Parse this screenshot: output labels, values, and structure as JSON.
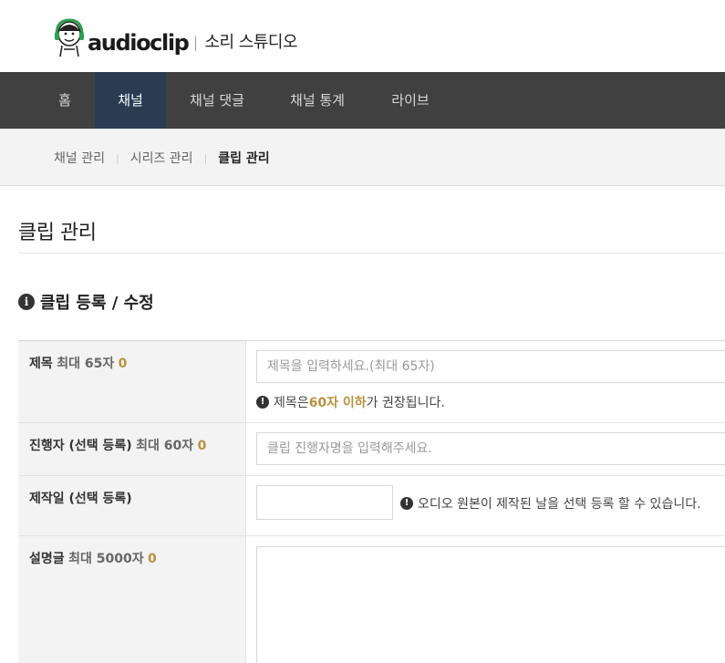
{
  "header": {
    "logo_text": "audioclip",
    "studio_label": "소리 스튜디오"
  },
  "gnb": {
    "items": [
      {
        "label": "홈"
      },
      {
        "label": "채널"
      },
      {
        "label": "채널 댓글"
      },
      {
        "label": "채널 통계"
      },
      {
        "label": "라이브"
      }
    ],
    "active_index": 1
  },
  "snb": {
    "items": [
      {
        "label": "채널 관리"
      },
      {
        "label": "시리즈 관리"
      },
      {
        "label": "클립 관리"
      }
    ],
    "separator": "|",
    "active_index": 2
  },
  "page": {
    "title": "클립 관리",
    "section_title": "클립 등록 / 수정"
  },
  "form": {
    "title": {
      "label": "제목",
      "limit": "최대 65자",
      "count": "0",
      "placeholder": "제목을 입력하세요.(최대 65자)",
      "note_prefix": "제목은 ",
      "note_highlight": "60자 이하",
      "note_suffix": "가 권장됩니다."
    },
    "host": {
      "label": "진행자 (선택 등록)",
      "limit": "최대 60자",
      "count": "0",
      "placeholder": "클립 진행자명을 입력해주세요."
    },
    "production_date": {
      "label": "제작일 (선택 등록)",
      "value": "",
      "note": "오디오 원본이 제작된 날을 선택 등록 할 수 있습니다."
    },
    "description": {
      "label": "설명글",
      "limit": "최대 5000자",
      "count": "0",
      "value": ""
    }
  },
  "colors": {
    "gnb_bg": "#404040",
    "gnb_active_bg": "#293c52",
    "accent_gold": "#b8913f",
    "snb_bg": "#f3f3f3"
  },
  "icons": {
    "mascot": "headphone-mascot-icon",
    "info": "info-circle-icon",
    "alert": "exclamation-circle-icon"
  }
}
